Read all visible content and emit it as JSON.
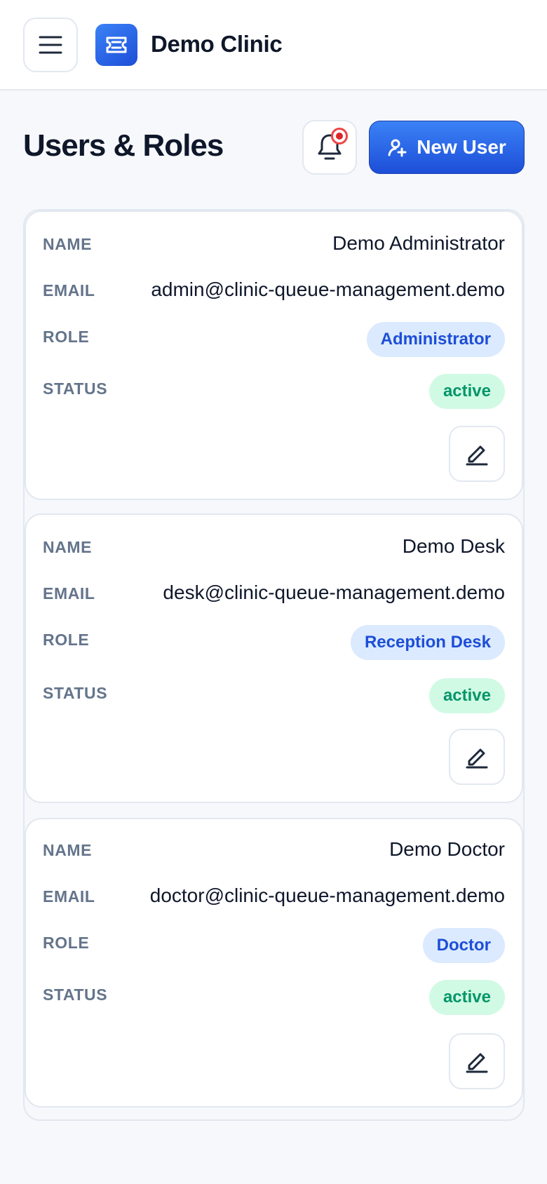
{
  "header": {
    "brand": "Demo Clinic",
    "menu_icon": "hamburger-icon",
    "logo_icon": "ticket-icon"
  },
  "page": {
    "title": "Users & Roles",
    "bell_icon": "bell-icon",
    "new_user_label": "New User",
    "new_user_icon": "user-plus-icon"
  },
  "labels": {
    "name": "NAME",
    "email": "EMAIL",
    "role": "ROLE",
    "status": "STATUS"
  },
  "users": [
    {
      "name": "Demo Administrator",
      "email": "admin@clinic-queue-management.demo",
      "role": "Administrator",
      "status": "active"
    },
    {
      "name": "Demo Desk",
      "email": "desk@clinic-queue-management.demo",
      "role": "Reception Desk",
      "status": "active"
    },
    {
      "name": "Demo Doctor",
      "email": "doctor@clinic-queue-management.demo",
      "role": "Doctor",
      "status": "active"
    }
  ],
  "colors": {
    "accent": "#2563eb",
    "role_badge_bg": "#dbeafe",
    "role_badge_text": "#1d4ed8",
    "status_badge_bg": "#d1fae5",
    "status_badge_text": "#059669",
    "notification": "#dc2626"
  }
}
